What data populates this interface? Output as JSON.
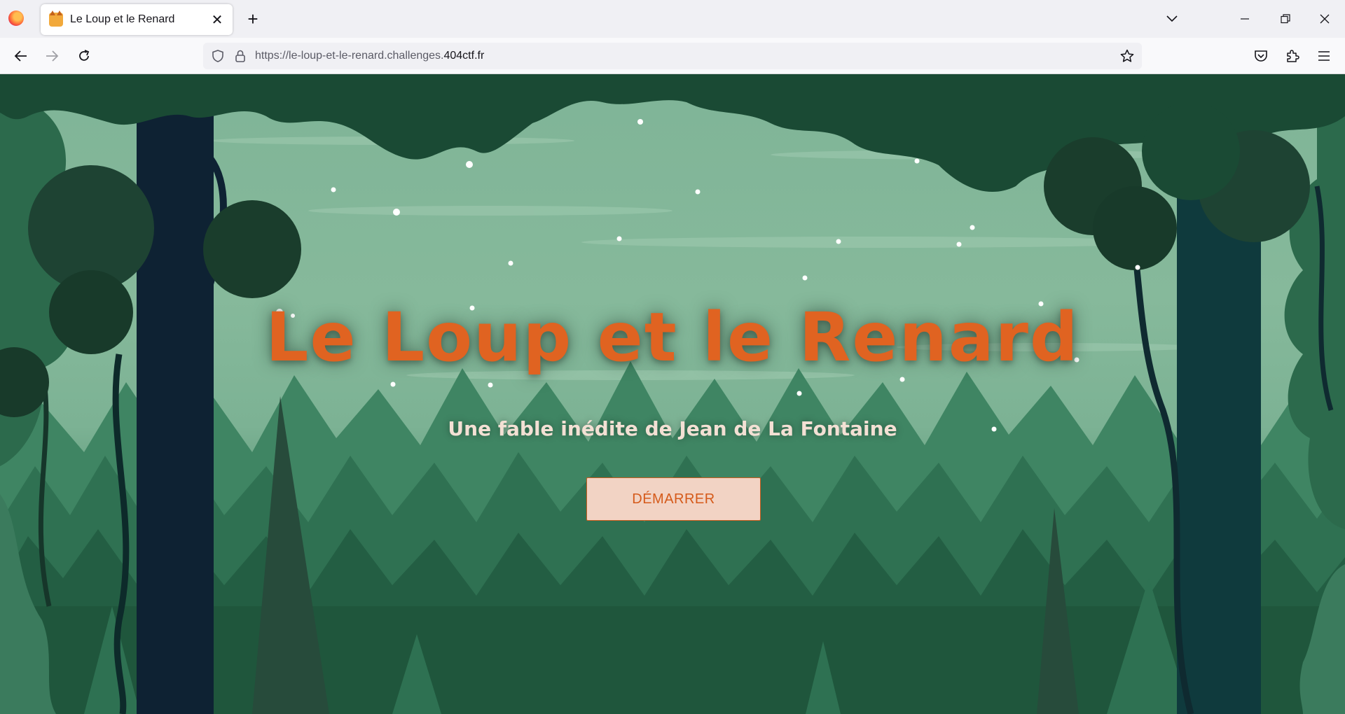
{
  "browser": {
    "tab_title": "Le Loup et le Renard",
    "url_prefix": "https://le-loup-et-le-renard.challenges.",
    "url_domain": "404ctf.fr",
    "new_tab_symbol": "+",
    "close_symbol": "✕"
  },
  "page": {
    "title": "Le Loup et le Renard",
    "subtitle": "Une fable inédite de Jean de La Fontaine",
    "start_button": "DÉMARRER"
  },
  "colors": {
    "title": "#e06321",
    "button_bg": "#f2d3c4",
    "button_text": "#d55a1a",
    "sky": "#7fb497",
    "forest_dark": "#1a4a34",
    "trunk": "#0e2233"
  }
}
